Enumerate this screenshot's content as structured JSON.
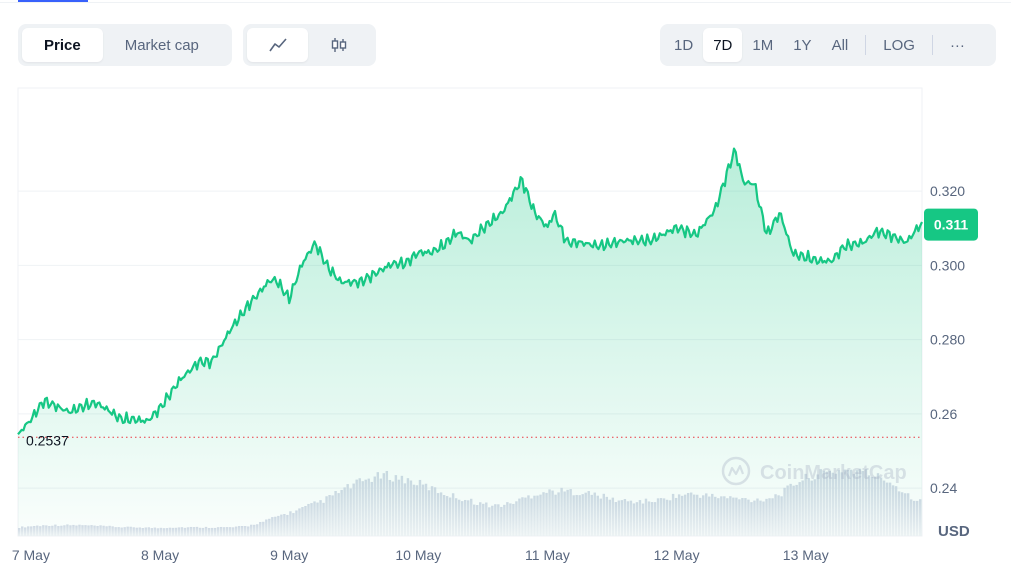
{
  "toolbar": {
    "type_tabs": [
      {
        "label": "Price",
        "active": true
      },
      {
        "label": "Market cap",
        "active": false
      }
    ],
    "chart_kind_icons": [
      "line-chart-icon",
      "candlestick-icon"
    ],
    "range_tabs": [
      {
        "label": "1D",
        "active": false
      },
      {
        "label": "7D",
        "active": true
      },
      {
        "label": "1M",
        "active": false
      },
      {
        "label": "1Y",
        "active": false
      },
      {
        "label": "All",
        "active": false
      },
      {
        "label": "LOG",
        "active": false
      }
    ],
    "more_label": "···"
  },
  "watermark": "CoinMarketCap",
  "colors": {
    "line": "#16c784",
    "accent": "#3861fb",
    "baseline": "#ea3943",
    "axis_text": "#58667e"
  },
  "chart_data": {
    "type": "area",
    "currency_label": "USD",
    "y_ticks": [
      "0.24",
      "0.26",
      "0.280",
      "0.300",
      "0.320"
    ],
    "y_tick_values": [
      0.24,
      0.26,
      0.28,
      0.3,
      0.32
    ],
    "ylim": [
      0.2271,
      0.3478
    ],
    "x_ticks": [
      "7 May",
      "8 May",
      "9 May",
      "10 May",
      "11 May",
      "12 May",
      "13 May"
    ],
    "x_tick_values": [
      0.1,
      1.1,
      2.1,
      3.1,
      4.1,
      5.1,
      6.1
    ],
    "xlim": [
      0,
      7
    ],
    "start_price": 0.2537,
    "start_price_label": "0.2537",
    "current_price": 0.311,
    "current_price_label": "0.311",
    "grid": true,
    "series": [
      {
        "x": [
          0,
          0.1,
          0.2,
          0.3,
          0.4,
          0.5,
          0.6,
          0.7,
          0.8,
          0.9,
          1.0,
          1.1,
          1.25,
          1.4,
          1.5,
          1.65,
          1.8,
          1.95,
          2.0,
          2.1,
          2.2,
          2.3,
          2.4,
          2.5,
          2.65,
          2.8,
          2.9,
          3.0,
          3.1,
          3.2,
          3.3,
          3.4,
          3.5,
          3.6,
          3.75,
          3.9,
          4.0,
          4.05,
          4.1,
          4.15,
          4.25,
          4.35,
          4.5,
          4.7,
          4.8,
          4.9,
          5.1,
          5.25,
          5.4,
          5.55,
          5.62,
          5.7,
          5.8,
          5.9,
          6.0,
          6.2,
          6.3,
          6.4,
          6.55,
          6.65,
          6.75,
          6.88,
          7.0
        ],
        "y": [
          0.2545,
          0.2585,
          0.2635,
          0.262,
          0.2605,
          0.262,
          0.263,
          0.261,
          0.2585,
          0.2585,
          0.258,
          0.2615,
          0.269,
          0.274,
          0.274,
          0.283,
          0.29,
          0.296,
          0.296,
          0.291,
          0.3005,
          0.306,
          0.2995,
          0.2955,
          0.2955,
          0.2985,
          0.3005,
          0.3005,
          0.3035,
          0.3035,
          0.3055,
          0.309,
          0.3065,
          0.31,
          0.3142,
          0.3232,
          0.3142,
          0.3122,
          0.3102,
          0.3142,
          0.3062,
          0.3062,
          0.3052,
          0.3067,
          0.3067,
          0.3067,
          0.3102,
          0.3082,
          0.3152,
          0.3312,
          0.3222,
          0.3222,
          0.3082,
          0.3142,
          0.3032,
          0.3012,
          0.3012,
          0.3052,
          0.3062,
          0.3092,
          0.3082,
          0.3062,
          0.3117
        ],
        "volume": [
          0.12,
          0.14,
          0.15,
          0.15,
          0.15,
          0.14,
          0.13,
          0.12,
          0.12,
          0.11,
          0.12,
          0.12,
          0.12,
          0.12,
          0.12,
          0.14,
          0.2,
          0.28,
          0.34,
          0.42,
          0.5,
          0.62,
          0.72,
          0.8,
          0.84,
          0.8,
          0.74,
          0.66,
          0.58,
          0.52,
          0.46,
          0.42,
          0.44,
          0.52,
          0.6,
          0.62,
          0.62,
          0.6,
          0.56,
          0.5,
          0.48,
          0.48,
          0.5,
          0.56,
          0.58,
          0.56,
          0.54,
          0.52,
          0.5,
          0.52,
          0.6,
          0.76,
          0.84,
          0.88,
          0.92,
          0.9,
          0.84,
          0.76,
          0.6,
          0.48
        ]
      }
    ]
  }
}
